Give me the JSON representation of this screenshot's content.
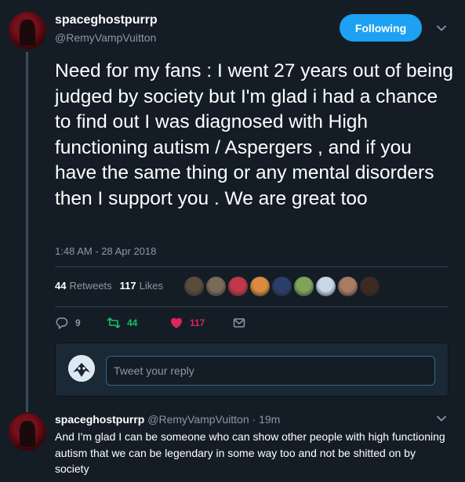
{
  "tweet": {
    "display_name": "spaceghostpurrp",
    "handle": "@RemyVampVuitton",
    "follow_label": "Following",
    "text": "Need for my fans : I went 27 years out of being judged by society but I'm glad i had a chance to find out I was diagnosed with High functioning autism / Aspergers , and if you have the same thing or any mental disorders then I support you . We are great too",
    "timestamp": "1:48 AM - 28 Apr 2018",
    "retweets_count": "44",
    "retweets_label": "Retweets",
    "likes_count": "117",
    "likes_label": "Likes",
    "actions": {
      "reply_count": "9",
      "retweet_count": "44",
      "like_count": "117"
    }
  },
  "reply_compose": {
    "placeholder": "Tweet your reply"
  },
  "reply": {
    "display_name": "spaceghostpurrp",
    "handle": "@RemyVampVuitton",
    "separator": "·",
    "time": "19m",
    "text": "And I'm glad I can be someone who can show other people with high functioning autism that we can be legendary in some way too and not be shitted on by society"
  },
  "colors": {
    "background": "#141d26",
    "accent": "#1da1f2",
    "retweet": "#17bf63",
    "like": "#e0245e",
    "muted": "#8899a6"
  },
  "likers": [
    "#5a4a3a",
    "#7a6a5a",
    "#c0394b",
    "#d98c3f",
    "#2b3f6b",
    "#7fa35a",
    "#c7d6e8",
    "#a87b63",
    "#3d2a22"
  ]
}
